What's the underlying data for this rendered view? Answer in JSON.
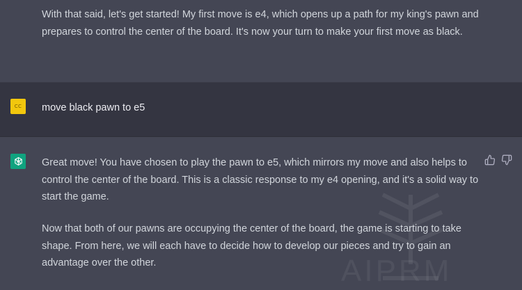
{
  "messages": {
    "previous_assistant": {
      "text": "With that said, let's get started! My first move is e4, which opens up a path for my king's pawn and prepares to control the center of the board. It's now your turn to make your first move as black."
    },
    "user": {
      "avatar_initials": "CC",
      "avatar_color": "#f2c70d",
      "text": "move black pawn to e5"
    },
    "assistant": {
      "avatar_icon": "openai-logo-icon",
      "avatar_color": "#10a37f",
      "paragraph_1": "Great move! You have chosen to play the pawn to e5, which mirrors my move and also helps to control the center of the board. This is a classic response to my e4 opening, and it's a solid way to start the game.",
      "paragraph_2": "Now that both of our pawns are occupying the center of the board, the game is starting to take shape. From here, we will each have to decide how to develop our pieces and try to gain an advantage over the other.",
      "feedback": {
        "thumbs_up_icon": "thumbs-up-icon",
        "thumbs_down_icon": "thumbs-down-icon"
      }
    }
  },
  "watermark": {
    "text": "AIPRM"
  }
}
